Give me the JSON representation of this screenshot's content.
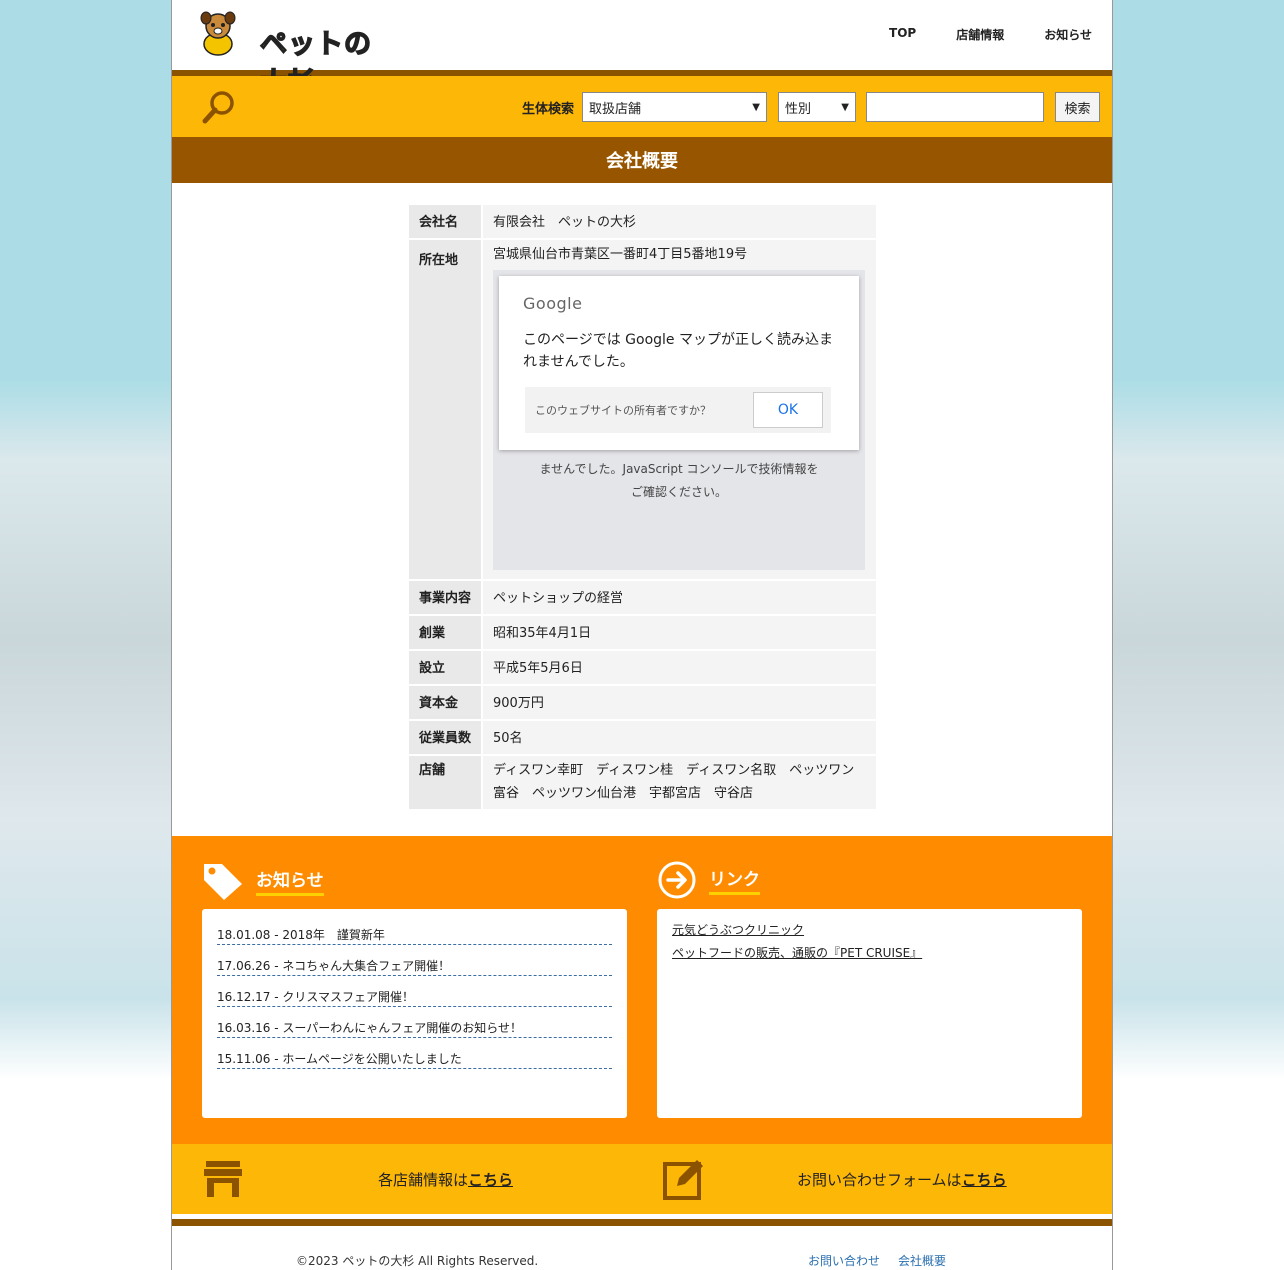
{
  "header": {
    "logo_text": "ペットの大杉",
    "nav": [
      "TOP",
      "店舗情報",
      "お知らせ"
    ]
  },
  "search": {
    "label": "生体検索",
    "store_select": "取扱店舗",
    "gender_select": "性別",
    "keyword_value": "",
    "button": "検索"
  },
  "page_title": "会社概要",
  "company": {
    "rows": [
      {
        "label": "会社名",
        "value": "有限会社　ペットの大杉"
      },
      {
        "label": "所在地",
        "value": "宮城県仙台市青葉区一番町4丁目5番地19号"
      },
      {
        "label": "事業内容",
        "value": "ペットショップの経営"
      },
      {
        "label": "創業",
        "value": "昭和35年4月1日"
      },
      {
        "label": "設立",
        "value": "平成5年5月6日"
      },
      {
        "label": "資本金",
        "value": "900万円"
      },
      {
        "label": "従業員数",
        "value": "50名"
      },
      {
        "label": "店舗",
        "value": "ディスワン幸町　ディスワン桂　ディスワン名取　ペッツワン富谷　ペッツワン仙台港　宇都宮店　守谷店"
      }
    ]
  },
  "map_error": {
    "brand": "Google",
    "message": "このページでは Google マップが正しく読み込まれませんでした。",
    "owner_question": "このウェブサイトの所有者ですか？",
    "ok": "OK",
    "background_text_1": "ませんでした。JavaScript コンソールで技術情報を",
    "background_text_2": "ご確認ください。"
  },
  "news": {
    "heading": "お知らせ",
    "items": [
      "18.01.08 - 2018年　謹賀新年",
      "17.06.26 - ネコちゃん大集合フェア開催！",
      "16.12.17 - クリスマスフェア開催！",
      "16.03.16 - スーパーわんにゃんフェア開催のお知らせ！",
      "15.11.06 - ホームページを公開いたしました"
    ]
  },
  "links": {
    "heading": "リンク",
    "items": [
      "元気どうぶつクリニック",
      "ペットフードの販売、通販の『PET CRUISE』"
    ]
  },
  "cta": {
    "store_text": "各店舗情報は",
    "store_link": "こちら",
    "contact_text": "お問い合わせフォームは",
    "contact_link": "こちら"
  },
  "footer": {
    "copyright": "©2023 ペットの大杉 All Rights Reserved.",
    "links": [
      "お問い合わせ",
      "会社概要"
    ]
  },
  "colors": {
    "header_yellow": "#fdb706",
    "title_brown": "#975500",
    "orange": "#ff8c00"
  }
}
